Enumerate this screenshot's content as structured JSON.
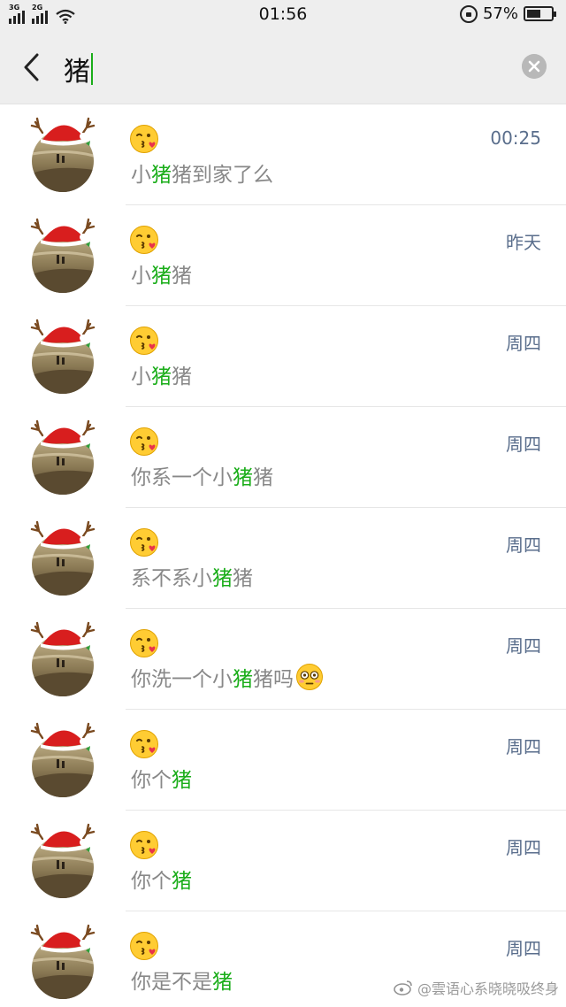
{
  "status_bar": {
    "network_1": "3G",
    "network_2": "2G",
    "time": "01:56",
    "battery": "57%",
    "battery_level": 0.57
  },
  "search": {
    "query": "猪",
    "back_icon": "chevron-left-icon",
    "clear_icon": "clear-circle-icon",
    "caret_color": "#1aad19"
  },
  "colors": {
    "highlight": "#1aad19",
    "message_text": "#888888",
    "time_text": "#5a6e8c"
  },
  "results": [
    {
      "sender_emoji": "kiss-emoji",
      "pre": "小",
      "match": "猪",
      "post": "猪到家了么",
      "time": "00:25",
      "trailing_emoji": ""
    },
    {
      "sender_emoji": "kiss-emoji",
      "pre": "小",
      "match": "猪",
      "post": "猪",
      "time": "昨天",
      "trailing_emoji": ""
    },
    {
      "sender_emoji": "kiss-emoji",
      "pre": "小",
      "match": "猪",
      "post": "猪",
      "time": "周四",
      "trailing_emoji": ""
    },
    {
      "sender_emoji": "kiss-emoji",
      "pre": "你系一个小",
      "match": "猪",
      "post": "猪",
      "time": "周四",
      "trailing_emoji": ""
    },
    {
      "sender_emoji": "kiss-emoji",
      "pre": "系不系小",
      "match": "猪",
      "post": "猪",
      "time": "周四",
      "trailing_emoji": ""
    },
    {
      "sender_emoji": "kiss-emoji",
      "pre": "你洗一个小",
      "match": "猪",
      "post": "猪吗",
      "time": "周四",
      "trailing_emoji": "flushed-emoji"
    },
    {
      "sender_emoji": "kiss-emoji",
      "pre": "你个",
      "match": "猪",
      "post": "",
      "time": "周四",
      "trailing_emoji": ""
    },
    {
      "sender_emoji": "kiss-emoji",
      "pre": "你个",
      "match": "猪",
      "post": "",
      "time": "周四",
      "trailing_emoji": ""
    },
    {
      "sender_emoji": "kiss-emoji",
      "pre": "你是不是",
      "match": "猪",
      "post": "",
      "time": "周四",
      "trailing_emoji": ""
    }
  ],
  "watermark": {
    "text": "@雲语心系晓晓吸终身",
    "icon": "weibo-logo-icon"
  }
}
